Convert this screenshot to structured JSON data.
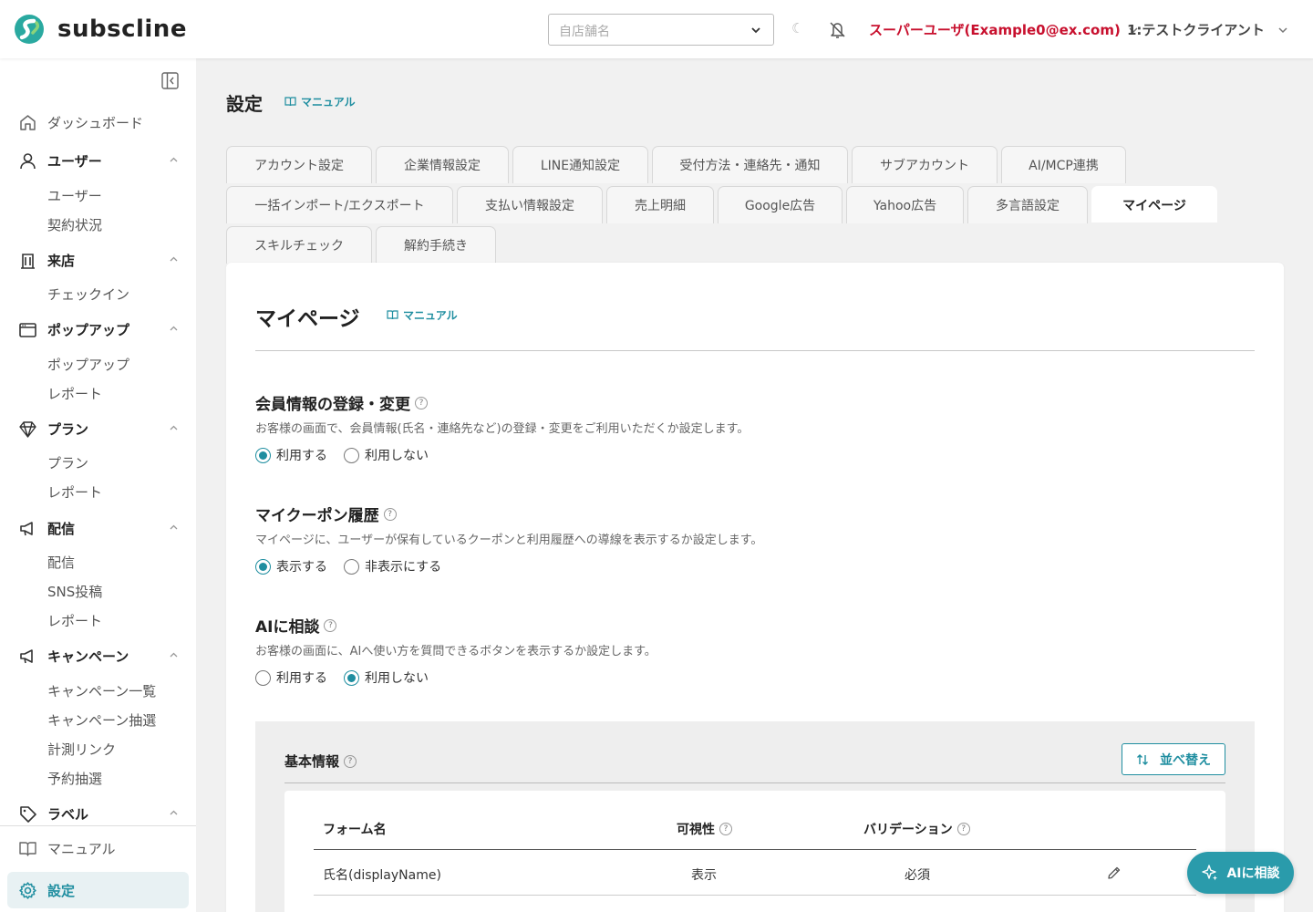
{
  "header": {
    "logo_text": "subscline",
    "store_placeholder": "自店舗名",
    "user_label": "スーパーユーザ(Example0@ex.com)",
    "client_label": "1:テストクライアント",
    "moon_glyph": "☾"
  },
  "sidebar": {
    "dashboard": "ダッシュボード",
    "groups": {
      "users": {
        "label": "ユーザー",
        "items": [
          "ユーザー",
          "契約状況"
        ]
      },
      "visit": {
        "label": "来店",
        "items": [
          "チェックイン"
        ]
      },
      "popup": {
        "label": "ポップアップ",
        "items": [
          "ポップアップ",
          "レポート"
        ]
      },
      "plan": {
        "label": "プラン",
        "items": [
          "プラン",
          "レポート"
        ]
      },
      "delivery": {
        "label": "配信",
        "items": [
          "配信",
          "SNS投稿",
          "レポート"
        ]
      },
      "campaign": {
        "label": "キャンペーン",
        "items": [
          "キャンペーン一覧",
          "キャンペーン抽選",
          "計測リンク",
          "予約抽選"
        ]
      },
      "label": {
        "label": "ラベル"
      }
    },
    "manual": "マニュアル",
    "settings": "設定"
  },
  "page": {
    "title": "設定",
    "manual": "マニュアル"
  },
  "tabs": [
    "アカウント設定",
    "企業情報設定",
    "LINE通知設定",
    "受付方法・連絡先・通知",
    "サブアカウント",
    "AI/MCP連携",
    "一括インポート/エクスポート",
    "支払い情報設定",
    "売上明細",
    "Google広告",
    "Yahoo広告",
    "多言語設定",
    "マイページ",
    "スキルチェック",
    "解約手続き"
  ],
  "active_tab": "マイページ",
  "card": {
    "title": "マイページ",
    "manual": "マニュアル",
    "help_glyph": "?",
    "sections": [
      {
        "title": "会員情報の登録・変更",
        "desc": "お客様の画面で、会員情報(氏名・連絡先など)の登録・変更をご利用いただくか設定します。",
        "options": [
          "利用する",
          "利用しない"
        ],
        "selected": 0
      },
      {
        "title": "マイクーポン履歴",
        "desc": "マイページに、ユーザーが保有しているクーポンと利用履歴への導線を表示するか設定します。",
        "options": [
          "表示する",
          "非表示にする"
        ],
        "selected": 0
      },
      {
        "title": "AIに相談",
        "desc": "お客様の画面に、AIへ使い方を質問できるボタンを表示するか設定します。",
        "options": [
          "利用する",
          "利用しない"
        ],
        "selected": 1
      }
    ],
    "basic": {
      "title": "基本情報",
      "sort_button": "並べ替え",
      "columns": [
        "フォーム名",
        "可視性",
        "バリデーション"
      ],
      "rows": [
        {
          "name": "氏名(displayName)",
          "visibility": "表示",
          "validation": "必須"
        }
      ]
    }
  },
  "fab": {
    "label": "AIに相談"
  },
  "colors": {
    "accent": "#1f8ea0",
    "user_red": "#c8102e"
  }
}
